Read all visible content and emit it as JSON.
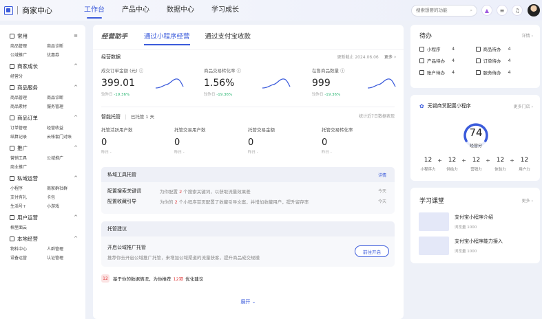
{
  "header": {
    "brand": "商家中心",
    "nav": [
      "工作台",
      "产品中心",
      "数据中心",
      "学习成长"
    ],
    "active_nav": 0,
    "search_placeholder": "搜索想要的功能"
  },
  "sidebar": {
    "sections": [
      {
        "title": "常用",
        "icon": "grid-icon",
        "arrow": "≡",
        "items": [
          "商品管理",
          "商品诊断",
          "公域推广",
          "优惠券"
        ]
      },
      {
        "title": "商家成长",
        "icon": "heart-icon",
        "arrow": "^",
        "items": [
          "经营分"
        ]
      },
      {
        "title": "商品服务",
        "icon": "box-icon",
        "arrow": "^",
        "items": [
          "商品管理",
          "商品诊断",
          "商品素材",
          "服务管理"
        ]
      },
      {
        "title": "商品订单",
        "icon": "order-icon",
        "arrow": "^",
        "items": [
          "订单管理",
          "经营收益",
          "结算记录",
          "云帐套门对账"
        ]
      },
      {
        "title": "推广",
        "icon": "flag-icon",
        "arrow": "^",
        "items": [
          "营销工具",
          "公域推广",
          "商业推广"
        ]
      },
      {
        "title": "私域运营",
        "icon": "people-icon",
        "arrow": "^",
        "items": [
          "小程序",
          "商家群社群",
          "支付有礼",
          "卡包",
          "生活号+",
          "小游戏"
        ]
      },
      {
        "title": "用户运营",
        "icon": "user-icon",
        "arrow": "^",
        "items": [
          "棉里面云"
        ]
      },
      {
        "title": "本地经营",
        "icon": "shop-icon",
        "arrow": "^",
        "items": [
          "物料中心",
          "人群管理",
          "设备运营",
          "认证管理"
        ]
      }
    ]
  },
  "main": {
    "tabs": [
      "经营助手",
      "通过小程序经营",
      "通过支付宝收款"
    ],
    "active_tab": 1,
    "biz_data": {
      "title": "经营数据",
      "updated": "更新截止 2024.06.06",
      "more": "更多",
      "metrics": [
        {
          "label": "成交订单金额 (元)",
          "value": "399.01",
          "sub_label": "较昨日",
          "change": "-19.36%"
        },
        {
          "label": "商品交易转化率",
          "value": "1.56%",
          "sub_label": "较昨日",
          "change": "-19.36%"
        },
        {
          "label": "在售商品数量",
          "value": "999",
          "sub_label": "较昨日",
          "change": "-19.36%"
        }
      ]
    },
    "smart": {
      "title": "智能托管",
      "status": "已托管 1 天",
      "note": "统计近7日数据表现",
      "metrics": [
        {
          "label": "托管活跃用户数",
          "value": "0",
          "sub": "昨日 -"
        },
        {
          "label": "托管交易用户数",
          "value": "0",
          "sub": "昨日 -"
        },
        {
          "label": "托管交易金额",
          "value": "0",
          "sub": "昨日 -"
        },
        {
          "label": "托管交易转化率",
          "value": "0",
          "sub": "昨日 -"
        }
      ]
    },
    "private_tools": {
      "title": "私域工具托管",
      "detail": "详情",
      "rows": [
        {
          "name": "配置搜索关键词",
          "pre": "为你配置",
          "count": "2",
          "post": "个搜索关键词，以获取流量效果差",
          "when": "今天"
        },
        {
          "name": "配置收藏引导",
          "pre": "为你的",
          "count": "2",
          "post": "个小程序首页配置了收藏引导文案，并增加收藏用户，提升留存率",
          "when": "今天"
        }
      ]
    },
    "suggest": {
      "title": "托管建议",
      "item_title": "开启公域推广托管",
      "item_desc": "推荐你去开启公域推广托管，来增加公域渠道的流量获客，提升商品成交规模",
      "button": "前往开启"
    },
    "tip": {
      "badge": "12",
      "pre": "基于你的数据情况，为你推荐",
      "count": "12项",
      "post": "优化建议"
    },
    "expand": "展开"
  },
  "right": {
    "todo": {
      "title": "待办",
      "detail": "详情",
      "items": [
        {
          "label": "小程序",
          "count": "4",
          "icon": "app-icon"
        },
        {
          "label": "商品待办",
          "count": "4",
          "icon": "cube-icon"
        },
        {
          "label": "产品待办",
          "count": "4",
          "icon": "product-icon"
        },
        {
          "label": "订单待办",
          "count": "4",
          "icon": "receipt-icon"
        },
        {
          "label": "账户待办",
          "count": "4",
          "icon": "card-icon"
        },
        {
          "label": "服务待办",
          "count": "4",
          "icon": "service-icon"
        }
      ]
    },
    "score": {
      "title": "无锡商贸配置小程序",
      "more": "更多门店",
      "value": "74",
      "label": "经营分",
      "parts": [
        {
          "label": "小程序力",
          "value": "12"
        },
        {
          "label": "供给力",
          "value": "12"
        },
        {
          "label": "营销力",
          "value": "12"
        },
        {
          "label": "体验力",
          "value": "12"
        },
        {
          "label": "用户力",
          "value": "12"
        }
      ]
    },
    "learn": {
      "title": "学习课堂",
      "more": "更多",
      "courses": [
        {
          "title": "支付宝小程序介绍",
          "views": "浏览量 1000"
        },
        {
          "title": "支付宝小程序能力接入",
          "views": "浏览量 1000"
        }
      ]
    }
  },
  "colors": {
    "accent": "#3b5bdb",
    "negative": "#2bb673",
    "highlight": "#e03e3e"
  }
}
